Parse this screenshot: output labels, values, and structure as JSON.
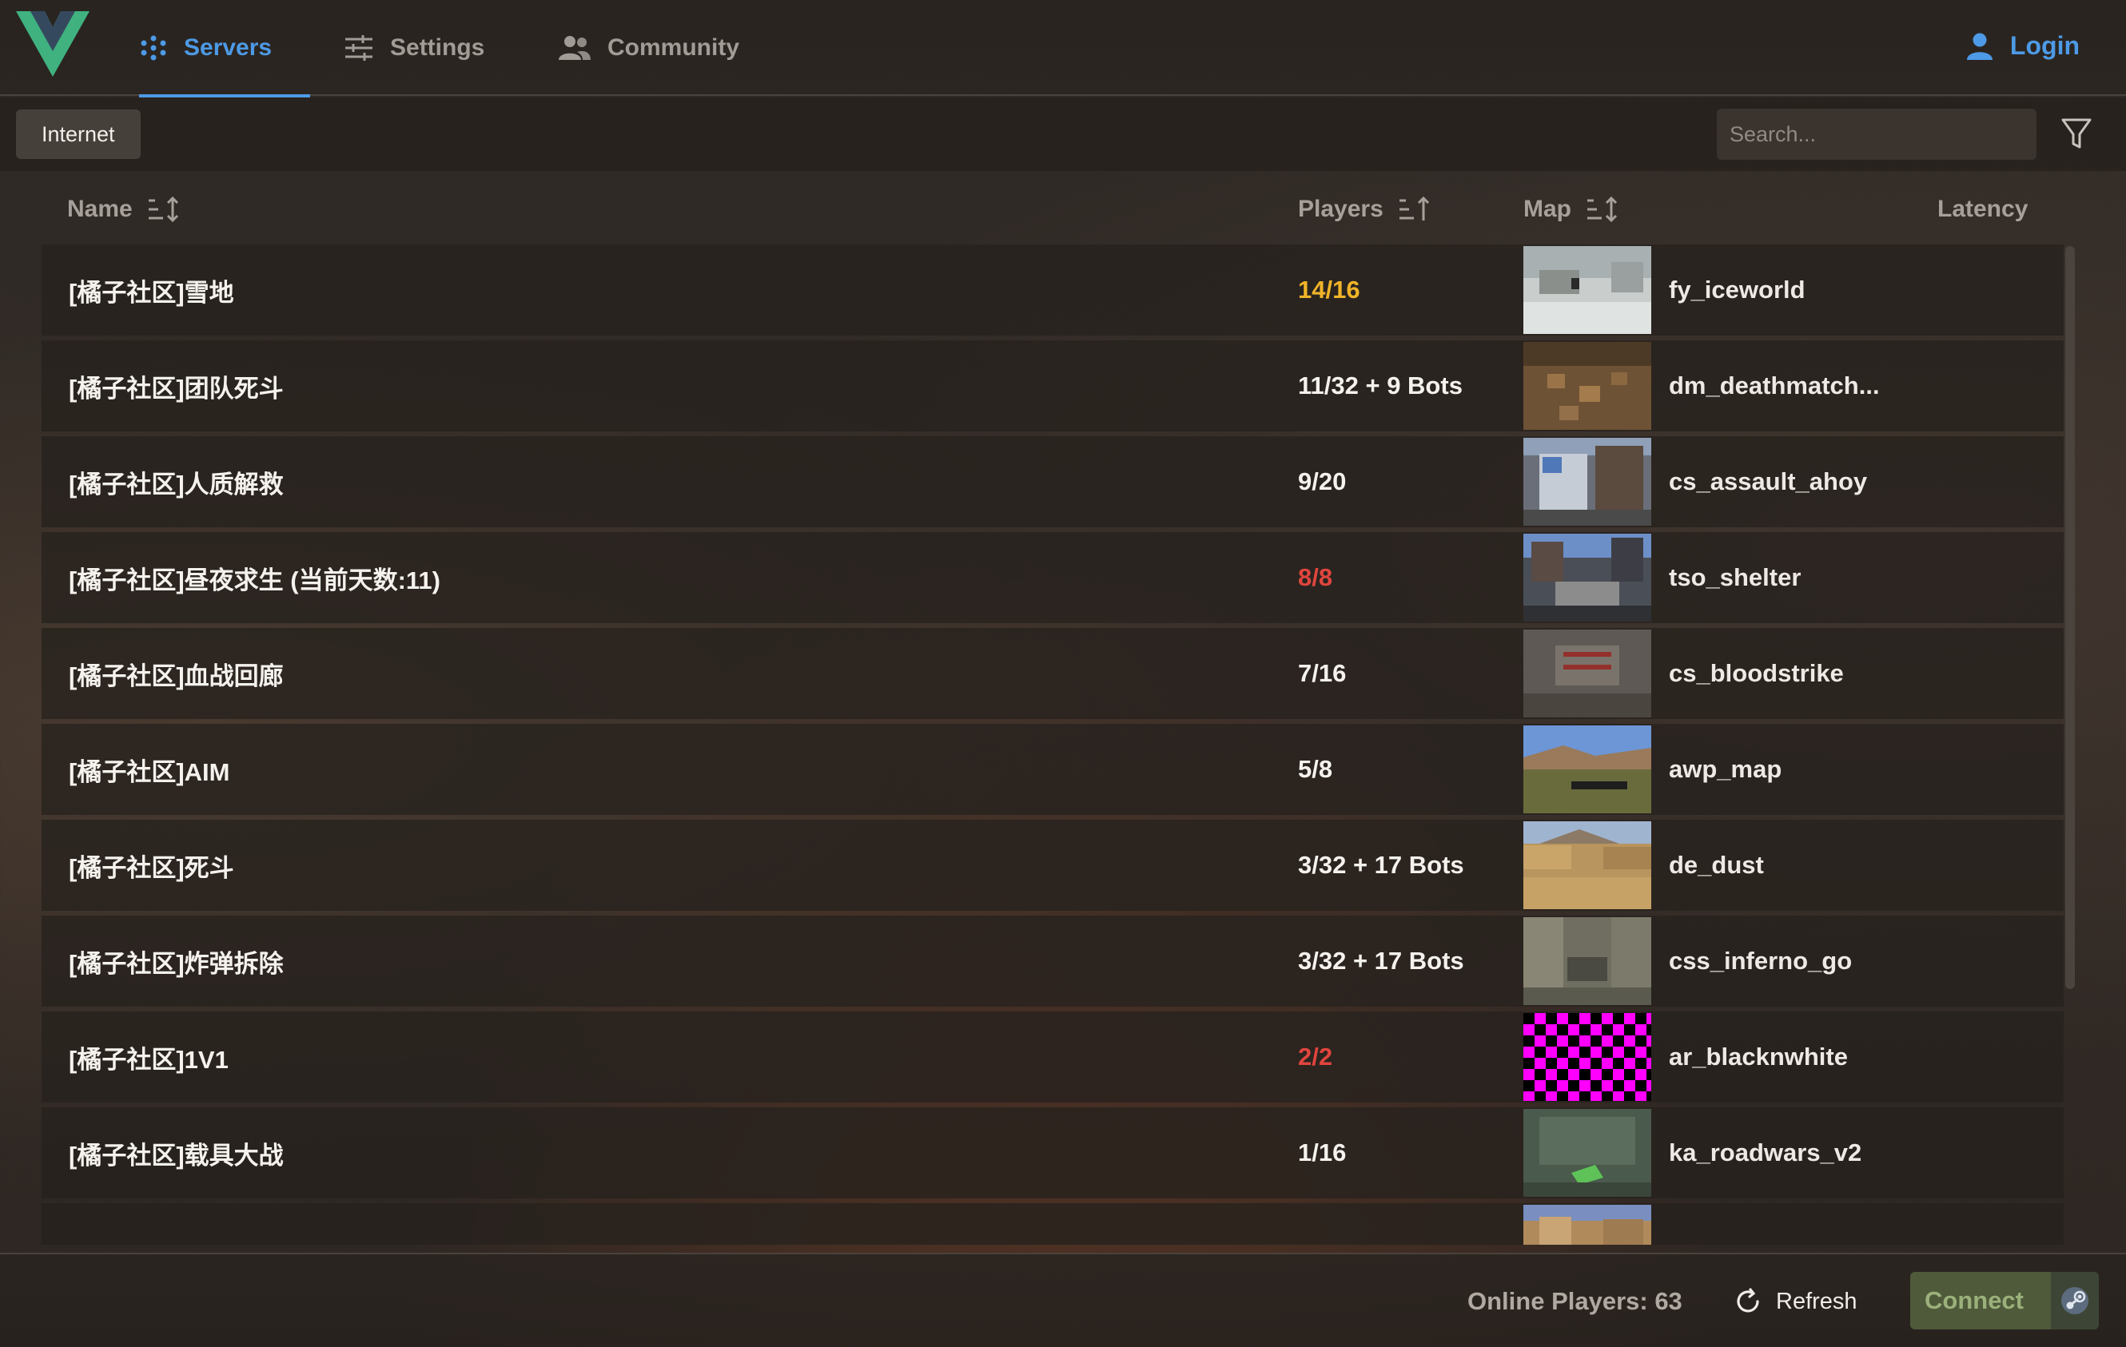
{
  "nav": {
    "tabs": [
      {
        "label": "Servers",
        "icon": "cluster-dots-icon",
        "active": true
      },
      {
        "label": "Settings",
        "icon": "sliders-icon",
        "active": false
      },
      {
        "label": "Community",
        "icon": "people-icon",
        "active": false
      }
    ],
    "login_label": "Login",
    "accent_color": "#4d9ae6"
  },
  "toolbar": {
    "source_chip": "Internet",
    "search_placeholder": "Search..."
  },
  "table": {
    "headers": {
      "name": "Name",
      "players": "Players",
      "map": "Map",
      "latency": "Latency"
    },
    "rows": [
      {
        "name": "[橘子社区]雪地",
        "players": "14/16",
        "status": "warn",
        "map": "fy_iceworld"
      },
      {
        "name": "[橘子社区]团队死斗",
        "players": "11/32 + 9 Bots",
        "status": "normal",
        "map": "dm_deathmatch..."
      },
      {
        "name": "[橘子社区]人质解救",
        "players": "9/20",
        "status": "normal",
        "map": "cs_assault_ahoy"
      },
      {
        "name": "[橘子社区]昼夜求生 (当前天数:11)",
        "players": "8/8",
        "status": "full",
        "map": "tso_shelter"
      },
      {
        "name": "[橘子社区]血战回廊",
        "players": "7/16",
        "status": "normal",
        "map": "cs_bloodstrike"
      },
      {
        "name": "[橘子社区]AIM",
        "players": "5/8",
        "status": "normal",
        "map": "awp_map"
      },
      {
        "name": "[橘子社区]死斗",
        "players": "3/32 + 17 Bots",
        "status": "normal",
        "map": "de_dust"
      },
      {
        "name": "[橘子社区]炸弹拆除",
        "players": "3/32 + 17 Bots",
        "status": "normal",
        "map": "css_inferno_go"
      },
      {
        "name": "[橘子社区]1V1",
        "players": "2/2",
        "status": "full",
        "map": "ar_blacknwhite"
      },
      {
        "name": "[橘子社区]载具大战",
        "players": "1/16",
        "status": "normal",
        "map": "ka_roadwars_v2"
      },
      {
        "name": "",
        "players": "",
        "status": "normal",
        "map": ""
      }
    ],
    "status_colors": {
      "warn": "#f0b429",
      "full": "#e0453e",
      "normal": "#f5f2ee"
    }
  },
  "footer": {
    "online_players": "Online Players: 63",
    "refresh_label": "Refresh",
    "connect_label": "Connect"
  }
}
